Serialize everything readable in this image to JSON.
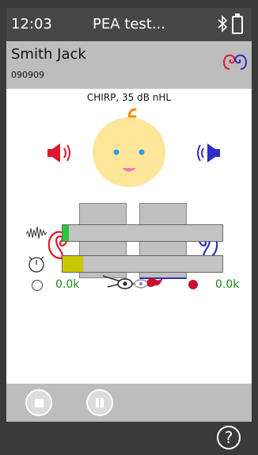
{
  "status": {
    "time": "12:03",
    "title": "PEA test...",
    "icons": [
      "bluetooth-icon",
      "battery-icon"
    ]
  },
  "patient": {
    "name": "Smith Jack",
    "id": "090909",
    "icons": [
      "right-ear-icon",
      "left-ear-icon"
    ]
  },
  "stimulus": {
    "label": "CHIRP, 35 dB nHL"
  },
  "indicators": {
    "noise": {
      "icon": "waveform-icon",
      "level": 0.04,
      "color": "#2bc43a"
    },
    "time": {
      "icon": "stopwatch-icon",
      "level": 0.13,
      "color": "#c8c800"
    }
  },
  "counters": {
    "left_count": "0.0k",
    "right_count": "0.0k",
    "electrode_icon": "electrode-cable-icon"
  },
  "controls": {
    "stop_icon": "stop-icon",
    "pause_icon": "pause-icon",
    "help_label": "?"
  },
  "colors": {
    "right_ear": "#e0162b",
    "left_ear": "#2d2dc8",
    "accent_green": "#1a8a1a"
  }
}
